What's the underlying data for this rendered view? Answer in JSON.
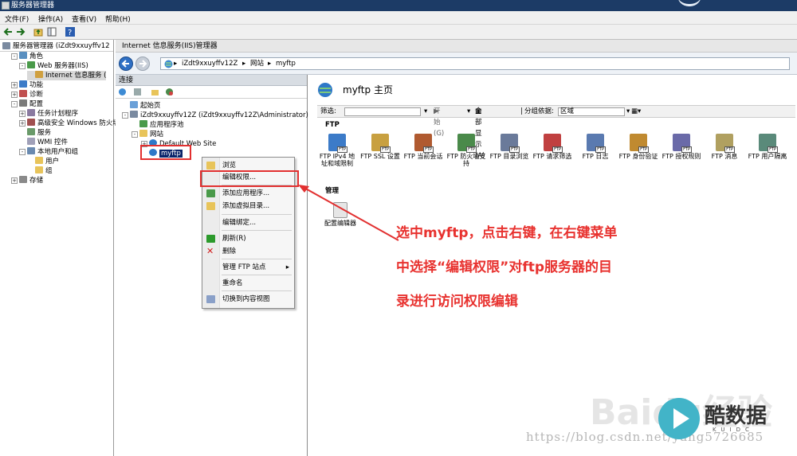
{
  "window": {
    "title": "服务器管理器"
  },
  "menubar": {
    "file": "文件(F)",
    "action": "操作(A)",
    "view": "查看(V)",
    "help": "帮助(H)"
  },
  "left_tree": {
    "root": "服务器管理器 (iZdt9xxuyffv12",
    "items": [
      {
        "label": "角色",
        "level": 1,
        "expander": "-"
      },
      {
        "label": "Web 服务器(IIS)",
        "level": 2,
        "expander": "-"
      },
      {
        "label": "Internet 信息服务 (",
        "level": 3,
        "expander": ""
      },
      {
        "label": "功能",
        "level": 1,
        "expander": "+"
      },
      {
        "label": "诊断",
        "level": 1,
        "expander": "+"
      },
      {
        "label": "配置",
        "level": 1,
        "expander": "-"
      },
      {
        "label": "任务计划程序",
        "level": 2,
        "expander": "+"
      },
      {
        "label": "高级安全 Windows 防火墙",
        "level": 2,
        "expander": "+"
      },
      {
        "label": "服务",
        "level": 2,
        "expander": ""
      },
      {
        "label": "WMI 控件",
        "level": 2,
        "expander": ""
      },
      {
        "label": "本地用户和组",
        "level": 2,
        "expander": "-"
      },
      {
        "label": "用户",
        "level": 3,
        "expander": ""
      },
      {
        "label": "组",
        "level": 3,
        "expander": ""
      },
      {
        "label": "存储",
        "level": 1,
        "expander": "+"
      }
    ]
  },
  "iis": {
    "title": "Internet 信息服务(IIS)管理器"
  },
  "address": {
    "server": "iZdt9xxuyffv12Z",
    "sites": "网站",
    "site": "myftp"
  },
  "connections": {
    "title": "连接",
    "tree": [
      {
        "label": "起始页",
        "level": 0,
        "expander": ""
      },
      {
        "label": "iZdt9xxuyffv12Z (iZdt9xxuyffv12Z\\Administrator)",
        "level": 0,
        "expander": "-"
      },
      {
        "label": "应用程序池",
        "level": 1,
        "expander": ""
      },
      {
        "label": "网站",
        "level": 1,
        "expander": "-"
      },
      {
        "label": "Default Web Site",
        "level": 2,
        "expander": "+"
      },
      {
        "label": "myftp",
        "level": 2,
        "expander": "",
        "selected": true
      }
    ]
  },
  "context_menu": {
    "items": [
      {
        "label": "浏览",
        "icon": "browse-icon"
      },
      {
        "label": "编辑权限...",
        "icon": ""
      },
      {
        "label": "添加应用程序...",
        "icon": "add-application-icon"
      },
      {
        "label": "添加虚拟目录...",
        "icon": "add-vdir-icon"
      },
      {
        "label": "编辑绑定...",
        "icon": ""
      },
      {
        "label": "刷新(R)",
        "icon": "refresh-icon"
      },
      {
        "label": "删除",
        "icon": "delete-icon"
      },
      {
        "label": "管理 FTP 站点",
        "icon": "",
        "submenu": "▸"
      },
      {
        "label": "重命名",
        "icon": ""
      },
      {
        "label": "切换到内容视图",
        "icon": "content-view-icon"
      }
    ]
  },
  "main": {
    "page_title": "myftp 主页",
    "filter_label": "筛选:",
    "go_label": "开始(G)",
    "show_all_label": "全部显示(A)",
    "group_by_label": "分组依据:",
    "group_by_value": "区域",
    "section_ftp": "FTP",
    "section_manage": "管理",
    "features": [
      {
        "label": "FTP IPv4 地址和域限制",
        "icon": "ftp-ipv4-icon"
      },
      {
        "label": "FTP SSL 设置",
        "icon": "ftp-ssl-icon"
      },
      {
        "label": "FTP 当前会话",
        "icon": "ftp-sessions-icon"
      },
      {
        "label": "FTP 防火墙支持",
        "icon": "ftp-firewall-icon"
      },
      {
        "label": "FTP 目录浏览",
        "icon": "ftp-directory-icon"
      },
      {
        "label": "FTP 请求筛选",
        "icon": "ftp-request-filter-icon"
      },
      {
        "label": "FTP 日志",
        "icon": "ftp-logging-icon"
      },
      {
        "label": "FTP 身份验证",
        "icon": "ftp-auth-icon"
      },
      {
        "label": "FTP 授权规则",
        "icon": "ftp-authorization-icon"
      },
      {
        "label": "FTP 消息",
        "icon": "ftp-messages-icon"
      },
      {
        "label": "FTP 用户隔离",
        "icon": "ftp-user-isolation-icon"
      }
    ],
    "manage_features": [
      {
        "label": "配置编辑器",
        "icon": "config-editor-icon"
      }
    ]
  },
  "annotation": {
    "lines": [
      "选中myftp，点击右键，在右键菜单",
      "中选择“编辑权限”对ftp服务器的目",
      "录进行访问权限编辑"
    ],
    "color": "#e8322f"
  },
  "watermark": {
    "url": "https://blog.csdn.net/yang5726685",
    "baidu": "Baidu经验",
    "brand": "酷数据",
    "brand_sub": "KUIDC"
  }
}
